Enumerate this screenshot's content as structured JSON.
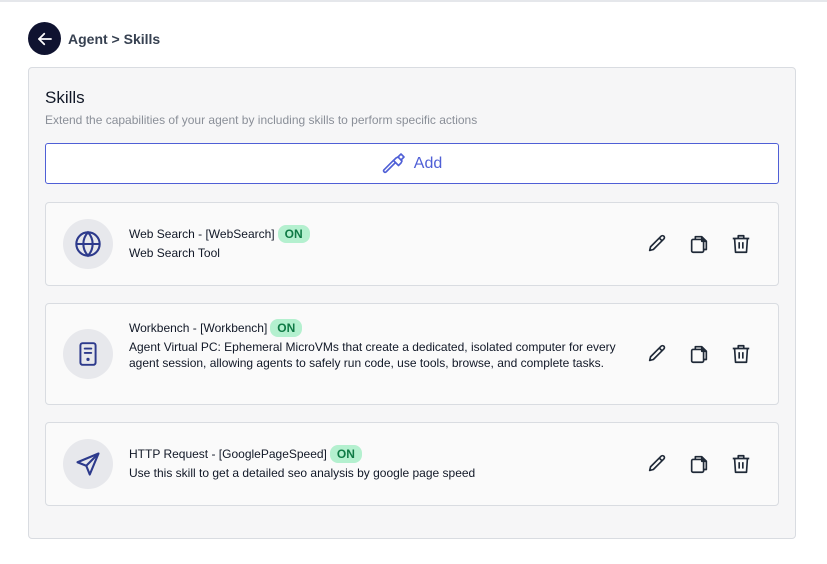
{
  "breadcrumb": "Agent > Skills",
  "section": {
    "title": "Skills",
    "subtitle": "Extend the capabilities of your agent by including skills to perform specific actions",
    "add_label": "Add"
  },
  "skills": [
    {
      "name": "Web Search - [WebSearch]",
      "status": "ON",
      "description": "Web Search Tool",
      "icon": "globe-icon"
    },
    {
      "name": "Workbench - [Workbench]",
      "status": "ON",
      "description": "Agent Virtual PC: Ephemeral MicroVMs that create a dedicated, isolated computer for every agent session, allowing agents to safely run code, use tools, browse, and complete tasks.",
      "icon": "server-icon"
    },
    {
      "name": "HTTP Request - [GooglePageSpeed]",
      "status": "ON",
      "description": "Use this skill to get a detailed seo analysis by google page speed",
      "icon": "send-icon"
    }
  ],
  "colors": {
    "accent": "#4f5fd6",
    "badge_bg": "#b4f0cf",
    "badge_text": "#0f7a45",
    "back_button": "#0f1330"
  }
}
